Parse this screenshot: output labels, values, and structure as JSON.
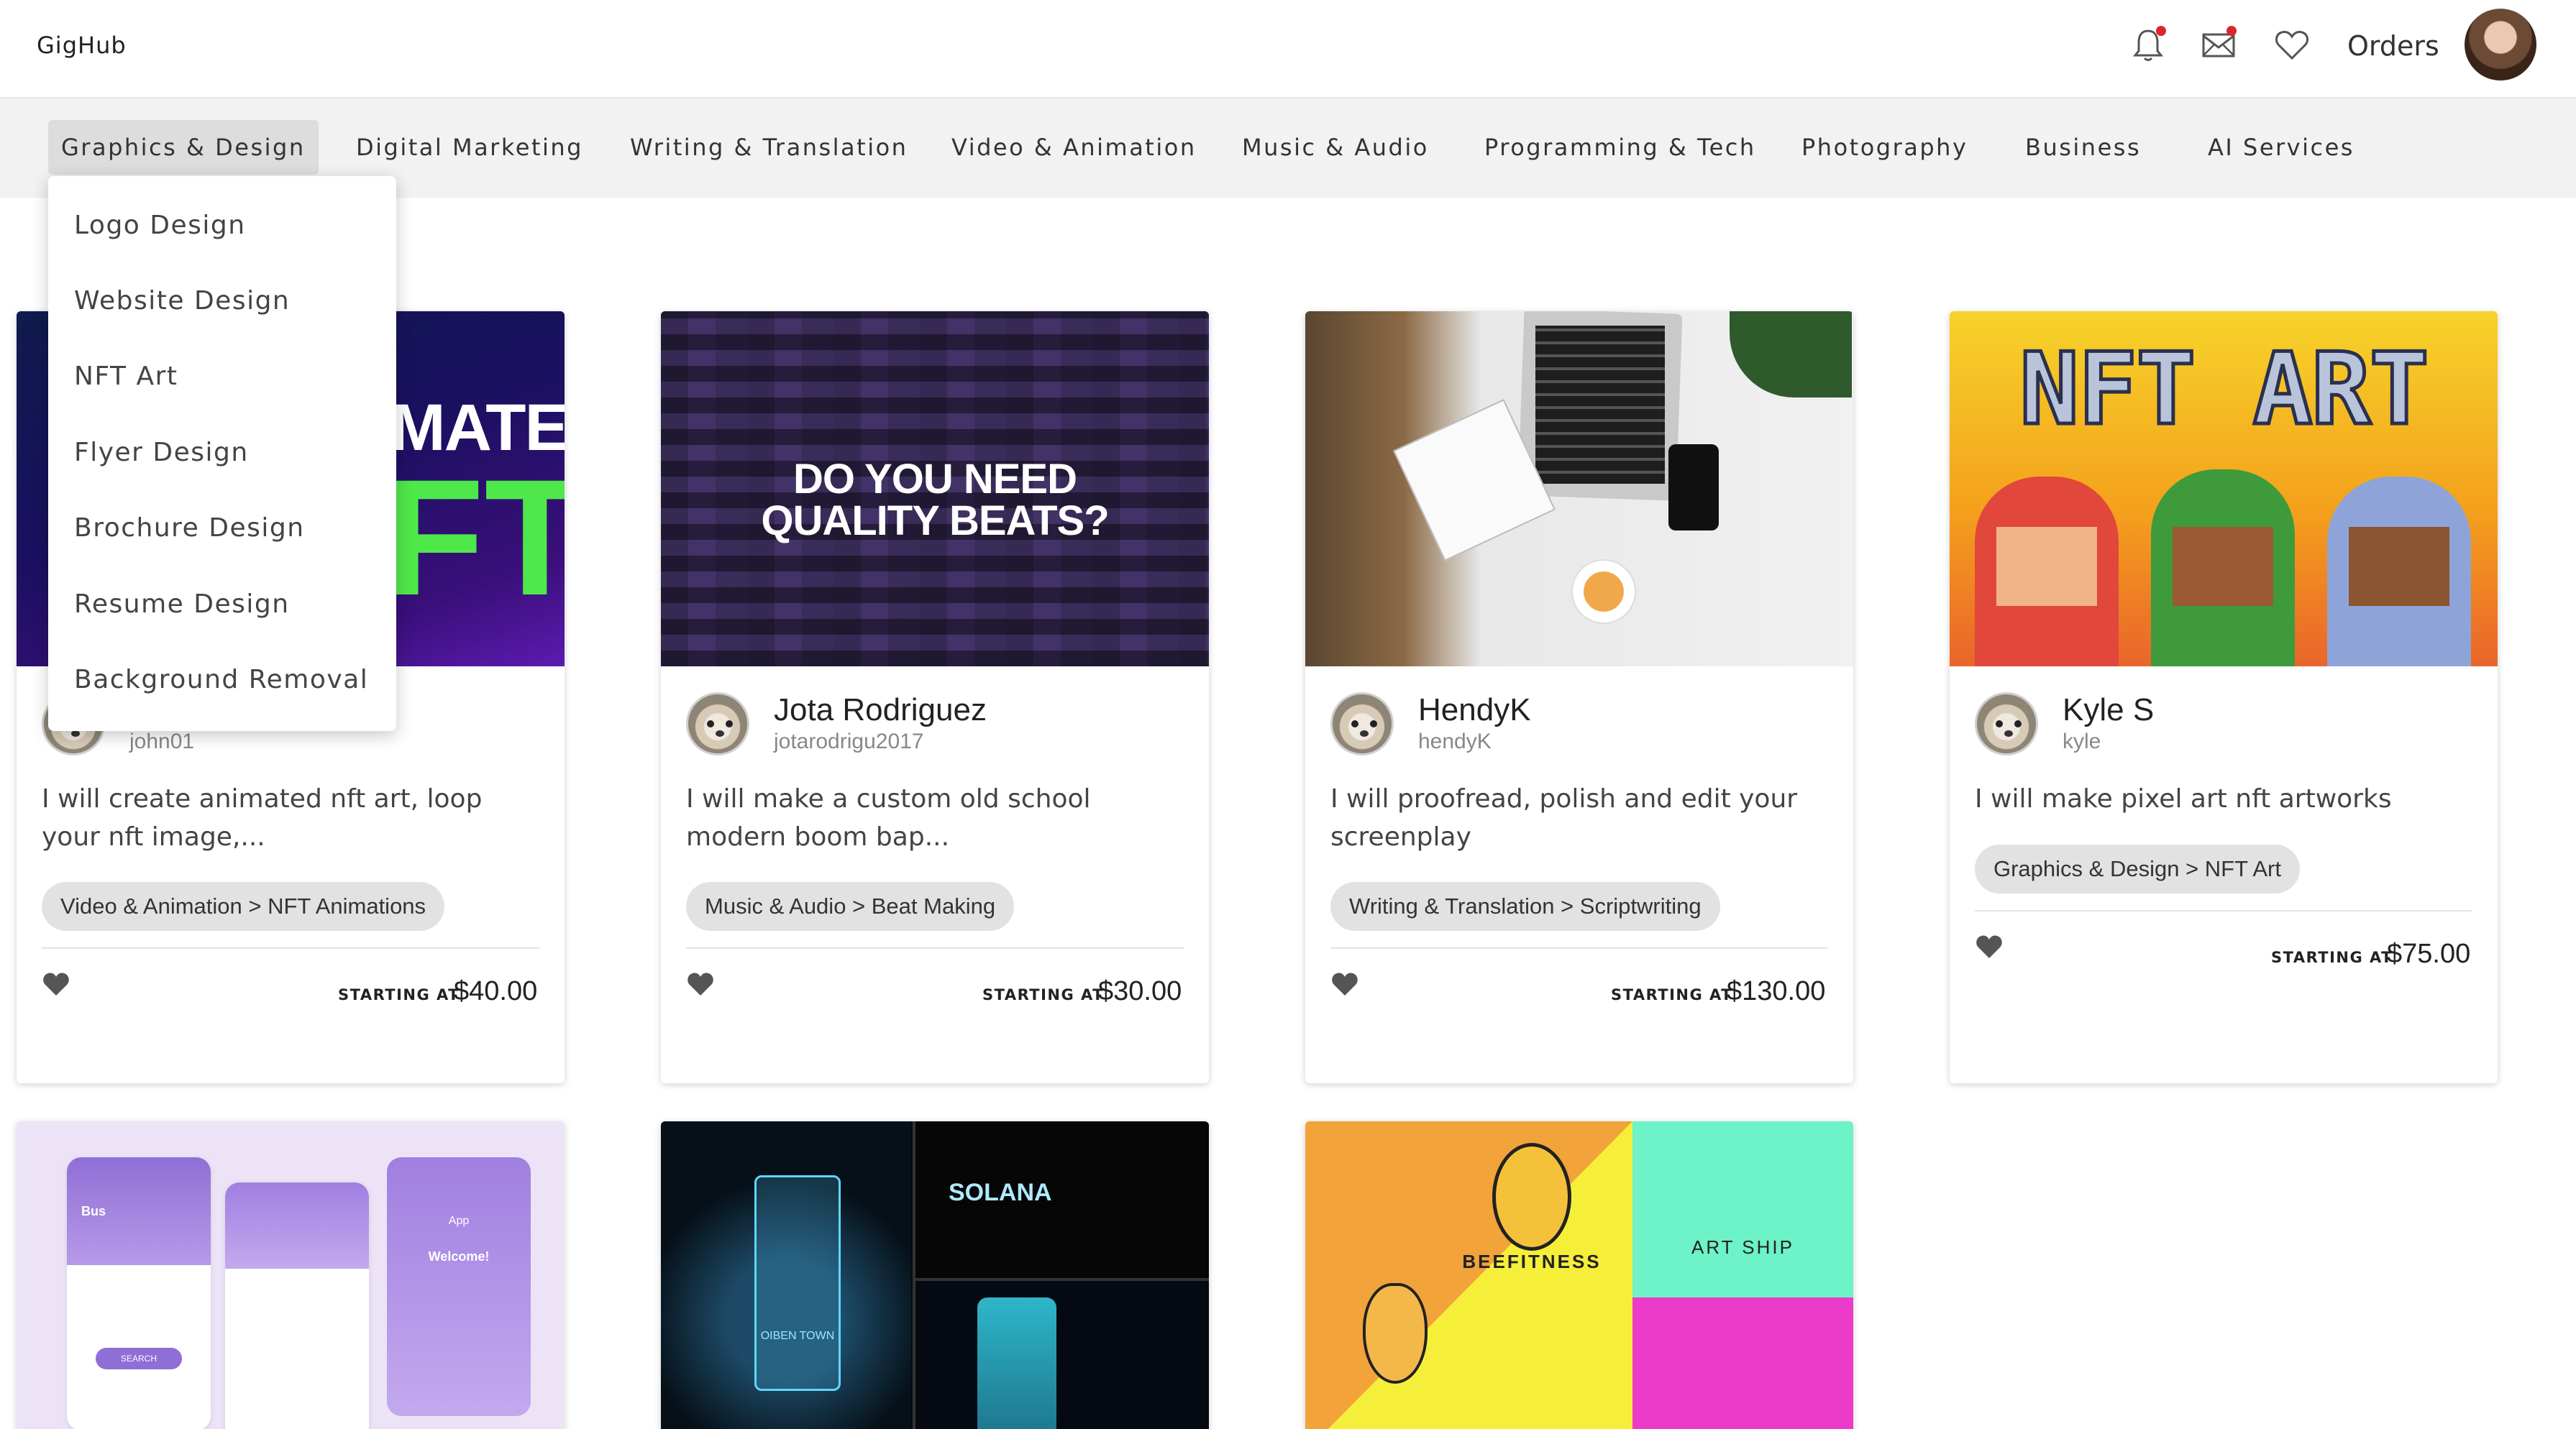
{
  "header": {
    "logo": "GigHub",
    "orders_label": "Orders"
  },
  "categories": [
    "Graphics & Design",
    "Digital Marketing",
    "Writing & Translation",
    "Video & Animation",
    "Music & Audio",
    "Programming & Tech",
    "Photography",
    "Business",
    "AI Services"
  ],
  "dropdown": {
    "items": [
      "Logo Design",
      "Website Design",
      "NFT Art",
      "Flyer Design",
      "Brochure Design",
      "Resume Design",
      "Background Removal"
    ]
  },
  "cards": [
    {
      "image_text": [
        "MATED",
        "FT"
      ],
      "seller_username": "john01",
      "title": "I will create animated nft art, loop your nft image,...",
      "tag": "Video & Animation > NFT Animations",
      "starting_label": "STARTING AT",
      "price": "$40.00"
    },
    {
      "image_text": [
        "DO YOU NEED",
        "QUALITY BEATS?"
      ],
      "seller_name": "Jota Rodriguez",
      "seller_username": "jotarodrigu2017",
      "title": "I will make a custom old school modern boom bap...",
      "tag": "Music & Audio > Beat Making",
      "starting_label": "STARTING AT",
      "price": "$30.00"
    },
    {
      "seller_name": "HendyK",
      "seller_username": "hendyK",
      "title": "I will proofread, polish and edit your screenplay",
      "tag": "Writing & Translation > Scriptwriting",
      "starting_label": "STARTING AT",
      "price": "$130.00"
    },
    {
      "image_text": [
        "NFT ART"
      ],
      "seller_name": "Kyle S",
      "seller_username": "kyle",
      "title": "I will make pixel art nft artworks",
      "tag": "Graphics & Design > NFT Art",
      "starting_label": "STARTING AT",
      "price": "$75.00"
    }
  ],
  "bottom_cards": [
    {
      "image_text": [
        "Bus",
        "SEARCH",
        "App",
        "Welcome!"
      ]
    },
    {
      "image_text": [
        "SOLANA",
        "OIBEN TOWN"
      ]
    },
    {
      "image_text": [
        "BEEFITNESS",
        "ART SHIP"
      ]
    }
  ]
}
